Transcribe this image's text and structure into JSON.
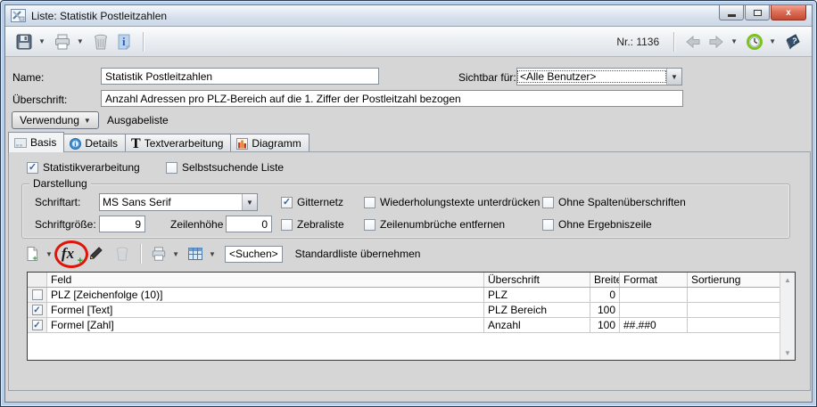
{
  "window": {
    "title": "Liste:  Statistik Postleitzahlen",
    "nr_label": "Nr.: 1136",
    "close_glyph": "x"
  },
  "form": {
    "name_label": "Name:",
    "name_value": "Statistik Postleitzahlen",
    "sichtbar_label": "Sichtbar für:",
    "sichtbar_value": "<Alle Benutzer>",
    "ueberschrift_label": "Überschrift:",
    "ueberschrift_value": "Anzahl Adressen pro PLZ-Bereich auf die 1. Ziffer der Postleitzahl bezogen",
    "verwendung_label": "Verwendung",
    "verwendung_value": "Ausgabeliste"
  },
  "tabs": [
    {
      "label": "Basis"
    },
    {
      "label": "Details"
    },
    {
      "label": "Textverarbeitung"
    },
    {
      "label": "Diagramm"
    }
  ],
  "basis": {
    "cb_statistik": "Statistikverarbeitung",
    "cb_selbstsuchend": "Selbstsuchende Liste",
    "darstellung": {
      "title": "Darstellung",
      "schriftart_label": "Schriftart:",
      "schriftart_value": "MS Sans Serif",
      "schriftgroesse_label": "Schriftgröße:",
      "schriftgroesse_value": "9",
      "zeilenhoehe_label": "Zeilenhöhe",
      "zeilenhoehe_value": "0",
      "cb_gitternetz": "Gitternetz",
      "cb_zebraliste": "Zebraliste",
      "cb_wiederholung": "Wiederholungstexte unterdrücken",
      "cb_zeilenumbrueche": "Zeilenumbrüche entfernen",
      "cb_ohne_spalten": "Ohne Spaltenüberschriften",
      "cb_ohne_ergebnis": "Ohne Ergebniszeile"
    },
    "list_toolbar": {
      "fx_glyph": "fx",
      "suchen_value": "<Suchen>",
      "standardliste_label": "Standardliste übernehmen"
    },
    "table": {
      "headers": {
        "feld": "Feld",
        "ueberschrift": "Überschrift",
        "breite": "Breite",
        "format": "Format",
        "sortierung": "Sortierung"
      },
      "rows": [
        {
          "checked": false,
          "feld": "PLZ [Zeichenfolge (10)]",
          "ueberschrift": "PLZ",
          "breite": "0",
          "format": "",
          "sortierung": ""
        },
        {
          "checked": true,
          "feld": "Formel [Text]",
          "ueberschrift": "PLZ Bereich",
          "breite": "100",
          "format": "",
          "sortierung": ""
        },
        {
          "checked": true,
          "feld": "Formel [Zahl]",
          "ueberschrift": "Anzahl",
          "breite": "100",
          "format": "##.##0",
          "sortierung": ""
        }
      ]
    }
  },
  "colors": {
    "annotation_red": "#e01408",
    "aero_border": "#b7cfe9",
    "client_bg": "#d6d6d6",
    "check_blue": "#3666a0"
  }
}
